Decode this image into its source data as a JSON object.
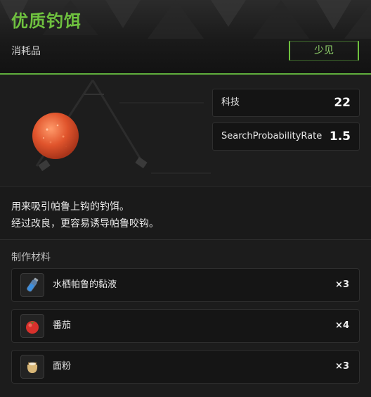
{
  "header": {
    "title": "优质钓饵",
    "category": "消耗品",
    "rarity": "少见"
  },
  "stats": [
    {
      "label": "科技",
      "value": "22"
    },
    {
      "label": "SearchProbabilityRate",
      "value": "1.5"
    }
  ],
  "description": {
    "line1": "用来吸引帕鲁上钩的钓饵。",
    "line2": "经过改良，更容易诱导帕鲁咬钩。"
  },
  "materials": {
    "header": "制作材料",
    "items": [
      {
        "name": "水栖帕鲁的黏液",
        "qty": "×3",
        "icon": "vial-icon"
      },
      {
        "name": "番茄",
        "qty": "×4",
        "icon": "tomato-icon"
      },
      {
        "name": "面粉",
        "qty": "×3",
        "icon": "flour-sack-icon"
      }
    ]
  },
  "colors": {
    "accent": "#6fc13f",
    "background": "#1c1c1c"
  }
}
